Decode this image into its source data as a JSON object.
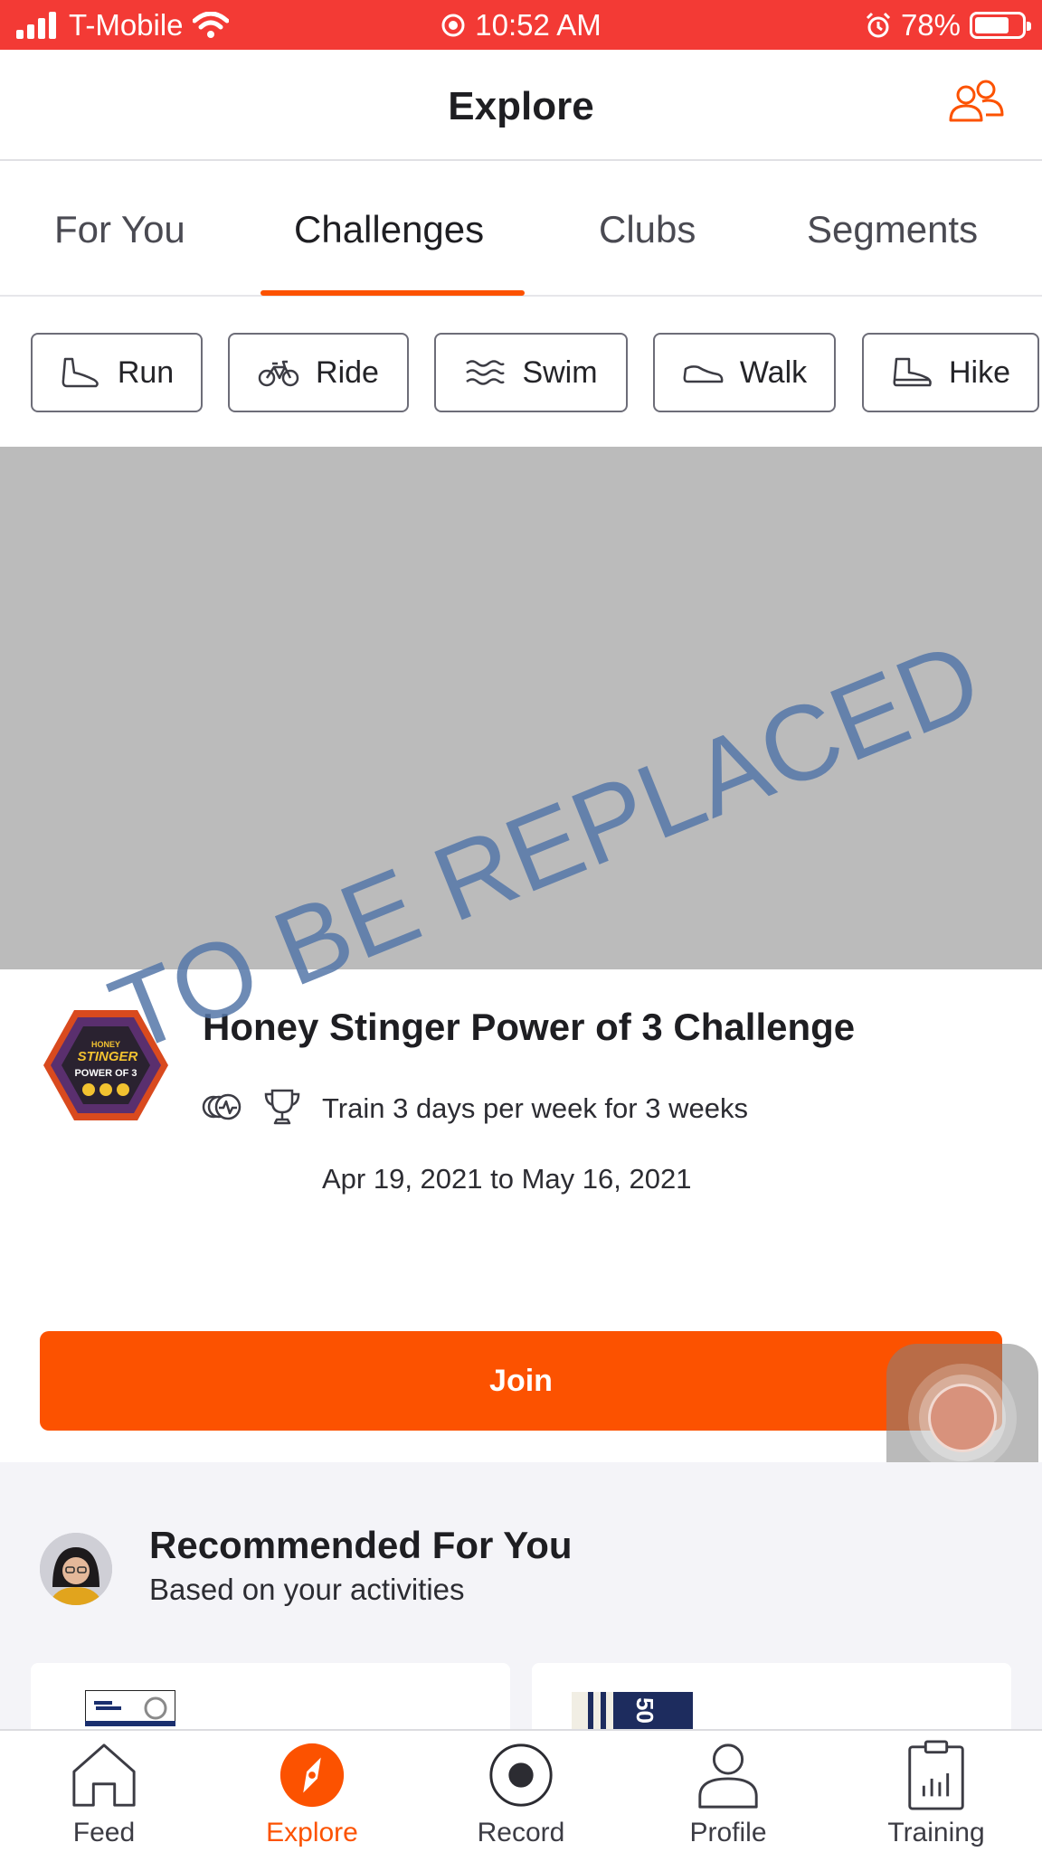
{
  "status_bar": {
    "carrier": "T-Mobile",
    "time": "10:52 AM",
    "battery": "78%",
    "icons": [
      "signal-icon",
      "wifi-icon",
      "location-icon",
      "alarm-icon",
      "battery-icon"
    ]
  },
  "header": {
    "title": "Explore",
    "friends_icon": "friends-icon"
  },
  "tabs": [
    {
      "label": "For You",
      "active": false
    },
    {
      "label": "Challenges",
      "active": true
    },
    {
      "label": "Clubs",
      "active": false
    },
    {
      "label": "Segments",
      "active": false
    }
  ],
  "sport_filters": [
    {
      "label": "Run",
      "icon": "run-shoe-icon"
    },
    {
      "label": "Ride",
      "icon": "bike-icon"
    },
    {
      "label": "Swim",
      "icon": "swim-icon"
    },
    {
      "label": "Walk",
      "icon": "walk-shoe-icon"
    },
    {
      "label": "Hike",
      "icon": "hike-boot-icon"
    }
  ],
  "banner": {
    "watermark": "TO BE REPLACED"
  },
  "challenge": {
    "badge_text_line1": "HONEY",
    "badge_text_line2": "STINGER",
    "badge_text_line3": "POWER OF 3",
    "title": "Honey Stinger Power of 3 Challenge",
    "description": "Train 3 days per week for 3 weeks",
    "dates": "Apr 19, 2021 to May 16, 2021",
    "join_label": "Join"
  },
  "recommended": {
    "title": "Recommended For You",
    "subtitle": "Based on your activities",
    "card_snippet": "50"
  },
  "bottom_nav": [
    {
      "label": "Feed",
      "icon": "home-icon",
      "active": false
    },
    {
      "label": "Explore",
      "icon": "compass-icon",
      "active": true
    },
    {
      "label": "Record",
      "icon": "record-icon",
      "active": false
    },
    {
      "label": "Profile",
      "icon": "profile-icon",
      "active": false
    },
    {
      "label": "Training",
      "icon": "training-icon",
      "active": false
    }
  ],
  "colors": {
    "status_bar": "#f33a35",
    "accent": "#fc5200",
    "banner_placeholder": "#bbbbbb",
    "watermark": "#5577a8",
    "section_bg": "#f4f4f8"
  }
}
